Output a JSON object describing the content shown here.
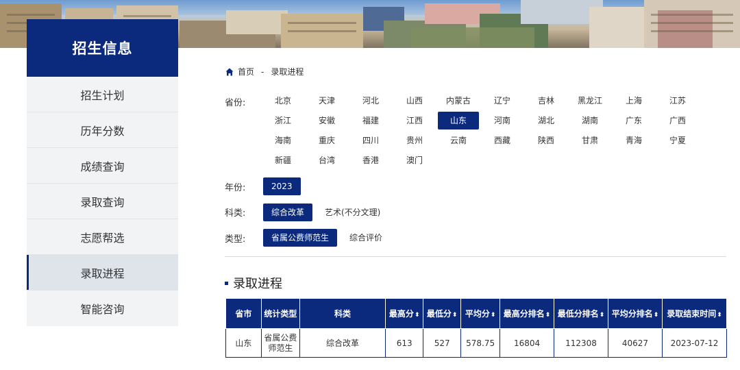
{
  "sidebar": {
    "title": "招生信息",
    "items": [
      {
        "label": "招生计划"
      },
      {
        "label": "历年分数"
      },
      {
        "label": "成绩查询"
      },
      {
        "label": "录取查询"
      },
      {
        "label": "志愿帮选"
      },
      {
        "label": "录取进程",
        "active": true
      },
      {
        "label": "智能咨询"
      }
    ]
  },
  "breadcrumb": {
    "home": "首页",
    "separator": "-",
    "current": "录取进程"
  },
  "filters": {
    "province_label": "省份:",
    "provinces": [
      "北京",
      "天津",
      "河北",
      "山西",
      "内蒙古",
      "辽宁",
      "吉林",
      "黑龙江",
      "上海",
      "江苏",
      "浙江",
      "安徽",
      "福建",
      "江西",
      "山东",
      "河南",
      "湖北",
      "湖南",
      "广东",
      "广西",
      "海南",
      "重庆",
      "四川",
      "贵州",
      "云南",
      "西藏",
      "陕西",
      "甘肃",
      "青海",
      "宁夏",
      "新疆",
      "台湾",
      "香港",
      "澳门"
    ],
    "selected_province": "山东",
    "year_label": "年份:",
    "years": [
      "2023"
    ],
    "subject_label": "科类:",
    "subjects": [
      "综合改革",
      "艺术(不分文理)"
    ],
    "selected_subject": "综合改革",
    "type_label": "类型:",
    "types": [
      "省属公费师范生",
      "综合评价"
    ],
    "selected_type": "省属公费师范生"
  },
  "section": {
    "title": "录取进程"
  },
  "table": {
    "headers": [
      "省市",
      "统计类型",
      "科类",
      "最高分",
      "最低分",
      "平均分",
      "最高分排名",
      "最低分排名",
      "平均分排名",
      "录取结束时间"
    ],
    "sortable": [
      false,
      false,
      false,
      true,
      true,
      true,
      true,
      true,
      true,
      true
    ],
    "rows": [
      [
        "山东",
        "省属公费师范生",
        "综合改革",
        "613",
        "527",
        "578.75",
        "16804",
        "112308",
        "40627",
        "2023-07-12"
      ]
    ]
  },
  "colors": {
    "primary": "#0b2a7e",
    "sidebar_bg": "#f2f3f5",
    "active_bg": "#dfe3ea"
  }
}
